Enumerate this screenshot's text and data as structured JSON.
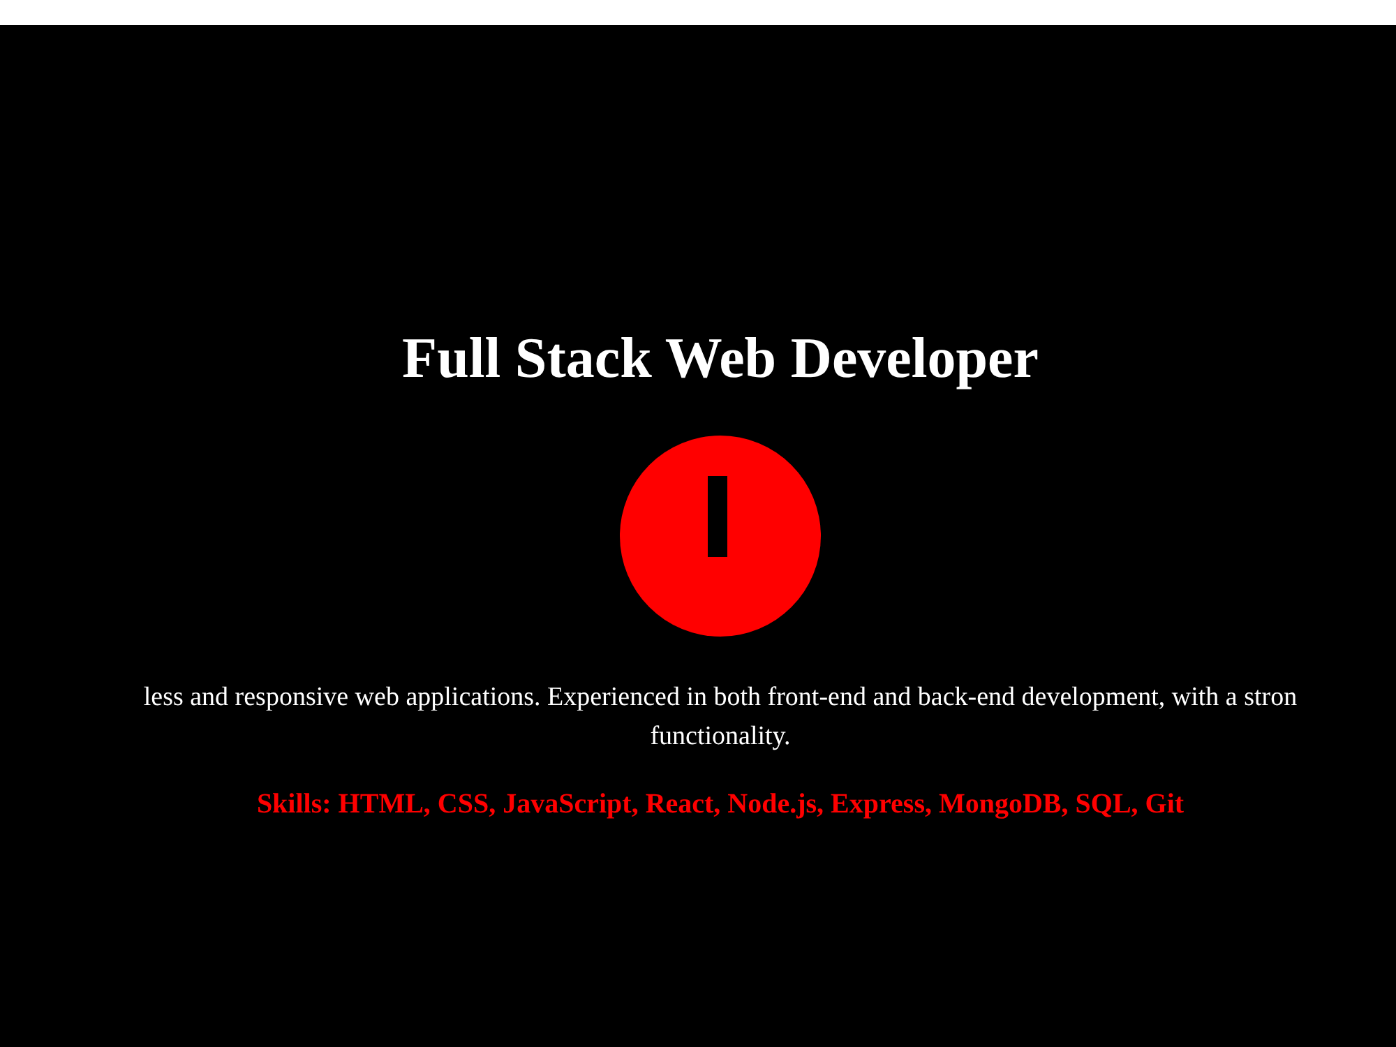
{
  "hero": {
    "title": "Full Stack Web Developer",
    "intro_lines": [
      "less and responsive web applications. Experienced in both front-end and back-end development, with a stron",
      "functionality."
    ],
    "skills": "Skills: HTML, CSS, JavaScript, React, Node.js, Express, MongoDB, SQL, Git"
  }
}
